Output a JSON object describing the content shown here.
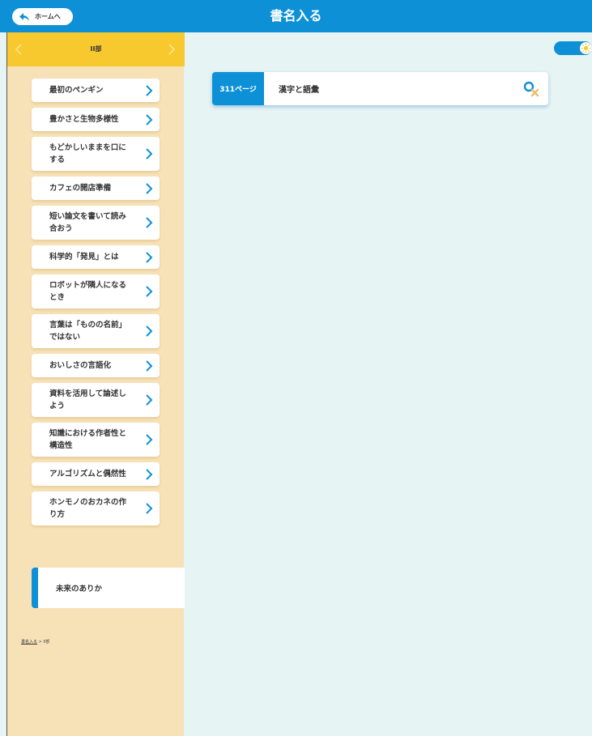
{
  "header": {
    "home_label": "ホームへ",
    "title": "書名入る"
  },
  "sidebar": {
    "section_title": "II部",
    "items": [
      {
        "label": "最初のペンギン"
      },
      {
        "label": "豊かさと生物多様性"
      },
      {
        "label": "もどかしいままを口にする"
      },
      {
        "label": "カフェの開店準備"
      },
      {
        "label": "短い論文を書いて読み合おう"
      },
      {
        "label": "科学的「発見」とは"
      },
      {
        "label": "ロボットが隣人になるとき"
      },
      {
        "label": "言葉は「ものの名前」ではない"
      },
      {
        "label": "おいしさの言語化"
      },
      {
        "label": "資料を活用して論述しよう"
      },
      {
        "label": "知識における作者性と構造性"
      },
      {
        "label": "アルゴリズムと偶然性"
      },
      {
        "label": "ホンモノのおカネの作り方"
      }
    ],
    "active_item": "未来のありか",
    "breadcrumb": {
      "link": "書名入る",
      "rest": "> II部"
    }
  },
  "main": {
    "result": {
      "page": "311ページ",
      "title": "漢字と語彙"
    }
  },
  "colors": {
    "header": "#0e90d6",
    "section_bar": "#f8c92e",
    "sidebar_bg": "#f7e2b8",
    "main_bg": "#e6f4f4"
  },
  "icons": {
    "home": "back-arrow-icon",
    "nav_prev": "chevron-left-icon",
    "nav_next": "chevron-right-icon",
    "item": "chevron-right-icon",
    "toggle": "sun-icon",
    "search_clear": "search-clear-icon"
  }
}
